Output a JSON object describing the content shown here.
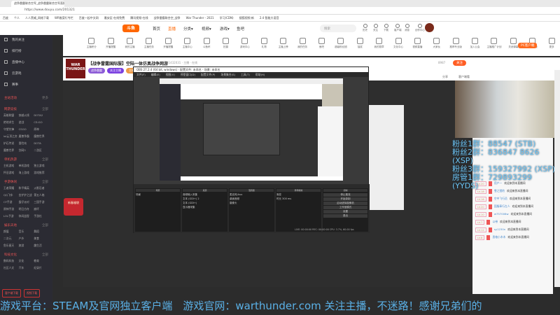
{
  "browser": {
    "tab_title": "战争雷霆联合空军_战争雷霆联合空军直播间",
    "url": "https://www.douyu.com/201321",
    "bookmarks": [
      "百度",
      "个人",
      "人人黑威_网络下载",
      "WR推案行专栏",
      "百度一起中文网",
      "雅安区-在线免费",
      "腾讯视频-在线",
      "战争雷霆联合空_战争",
      "War Thunder - 2021",
      "学习(CDN)",
      "搜狐视频·新",
      "2.4 智能大语音"
    ]
  },
  "header": {
    "logo": "斗鱼",
    "nav": [
      "首页",
      "直播",
      "分类▾",
      "视频▾",
      "游戏▾",
      "鱼吧"
    ],
    "search_placeholder": "搜索",
    "icons": [
      "历史",
      "关注",
      "下载",
      "客户端",
      "消息",
      "创作中心"
    ]
  },
  "sidebar": {
    "items": [
      "我的关注",
      "排行榜",
      "直播中心",
      "云游戏",
      "赛事"
    ],
    "sections": [
      {
        "title": "主站活动",
        "more": "更多"
      },
      {
        "title": "网游竞技",
        "more": "全部",
        "cells": [
          "英雄联盟",
          "穿越火线",
          "DOTA2",
          "绝地求生",
          "逆战",
          "CS:GO",
          "守望先锋",
          "CSGO",
          "原神",
          "lol云顶之弈",
          "魔兽争霸",
          "魔兽世界",
          "炉石传说",
          "冒险岛",
          "DOTA",
          "魔兽世界",
          "剑网3",
          "二游区"
        ]
      },
      {
        "title": "单机热游",
        "more": "全部",
        "cells": [
          "主机游戏",
          "单机游戏",
          "独立游戏",
          "怀旧游戏",
          "海上游戏",
          "游戏推荐"
        ]
      },
      {
        "title": "手游休闲",
        "more": "全部",
        "cells": [
          "王者荣耀",
          "和平精英",
          "火影忍者",
          "QQ飞车",
          "金铲铲之战",
          "第五人格",
          "CF手游",
          "蛋仔派对",
          "三国手游",
          "原神手游",
          "明日方舟",
          "崩坏",
          "LOL手游",
          "休闲益智",
          "手游社"
        ]
      },
      {
        "title": "娱乐天地",
        "more": "全部",
        "cells": [
          "颜值",
          "音乐",
          "舞蹈",
          "二次元",
          "户外",
          "美食",
          "鱼乐星天",
          "旅游",
          "趣生活"
        ]
      },
      {
        "title": "科技文化",
        "more": "全部",
        "cells": [
          "数码科技",
          "文化",
          "教育",
          "社区人文",
          "汽车",
          "纪录片"
        ]
      }
    ],
    "buttons": [
      "客户端下载",
      "视频下载"
    ]
  },
  "categories": [
    "主播积分",
    "开播提醒",
    "我的主播",
    "主播任务",
    "开播提醒",
    "主播中心",
    "斗鱼杯",
    "拍摄",
    "游戏中心",
    "礼物",
    "主播上榜",
    "我的任务",
    "鱼吧",
    "超级粉丝团",
    "抽奖",
    "我的勋章",
    "文化中心",
    "视频直播",
    "大家伙",
    "推荐专业版",
    "加入公会",
    "主播推广计划",
    "关闭弹幕",
    "设置屏蔽",
    "更多"
  ],
  "level_badge": "12",
  "pc_client": "PC客户端",
  "room": {
    "title": "【战争雷霆国际服】空陆一体仿真战争网游",
    "meta": "ID 1432031 · 主播 · 在线",
    "tags": [
      "战争雷霆",
      "关注主播",
      "主播勋章"
    ],
    "follow": "关注",
    "follow_count": "8987",
    "report": "分享",
    "client": "客户端看"
  },
  "obs": {
    "title": "OBS 27.2.4 (64 bit, windows) - 配置文件: 未命名 - 场景: 未命名",
    "menu": [
      "文件(F)",
      "编辑(E)",
      "视图(V)",
      "停靠窗口(D)",
      "配置文件(P)",
      "场景集合(S)",
      "工具(T)",
      "帮助(H)"
    ],
    "docks": [
      {
        "title": "场景",
        "items": [
          "场景"
        ]
      },
      {
        "title": "来源",
        "items": [
          "音频输入采集",
          "文本 (GDI+) 2",
          "文本 (GDI+)",
          "显示器采集"
        ]
      },
      {
        "title": "混音器",
        "items": [
          "麦克风/Aux",
          "桌面音频",
          "摄像头"
        ]
      },
      {
        "title": "转场特效",
        "items": [
          "渐变",
          "时长 300 ms"
        ]
      },
      {
        "title": "控制",
        "items": [
          "停止推流",
          "开始录制",
          "启动虚拟摄像机",
          "工作室模式",
          "设置",
          "退出"
        ]
      }
    ],
    "status": "LIVE: 00:00:00  REC: 00:00:00  CPU: 3.7%, 60.00 fps"
  },
  "overlay": [
    "粉丝1群：88547 (STB)",
    "粉丝2群：836847 8626 (XSP)",
    "粉丝3群：159327992 (XSP)",
    "房管1群：729893299 (YYDS)"
  ],
  "chat": [
    {
      "lv": "LV.20",
      "user": "用户一",
      "text": "欢迎来到本直播间"
    },
    {
      "lv": "LV.18",
      "user": "雪之猎豹",
      "text": "欢迎来到本直播间"
    },
    {
      "lv": "LV.16",
      "user": "空中飞行员",
      "text": "欢迎来到本直播间"
    },
    {
      "lv": "LV.20",
      "user": "国服奉行左人",
      "text": "欢迎来到本直播间"
    },
    {
      "lv": "LV.10",
      "user": "w757006w",
      "text": "欢迎来到本直播间"
    },
    {
      "lv": "LV.7",
      "user": "以带",
      "text": "欢迎来到本直播间"
    },
    {
      "lv": "LV.12",
      "user": "sy1230n",
      "text": "欢迎来到本直播间"
    },
    {
      "lv": "LV.8",
      "user": "思格小木木",
      "text": "欢迎来到本直播间"
    }
  ],
  "gift_badge": "新春福袋",
  "marquee": "游戏平台：STEAM及官网独立客户端　游戏官网：warthunder.com 关注主播，不迷路！感谢兄弟们的"
}
